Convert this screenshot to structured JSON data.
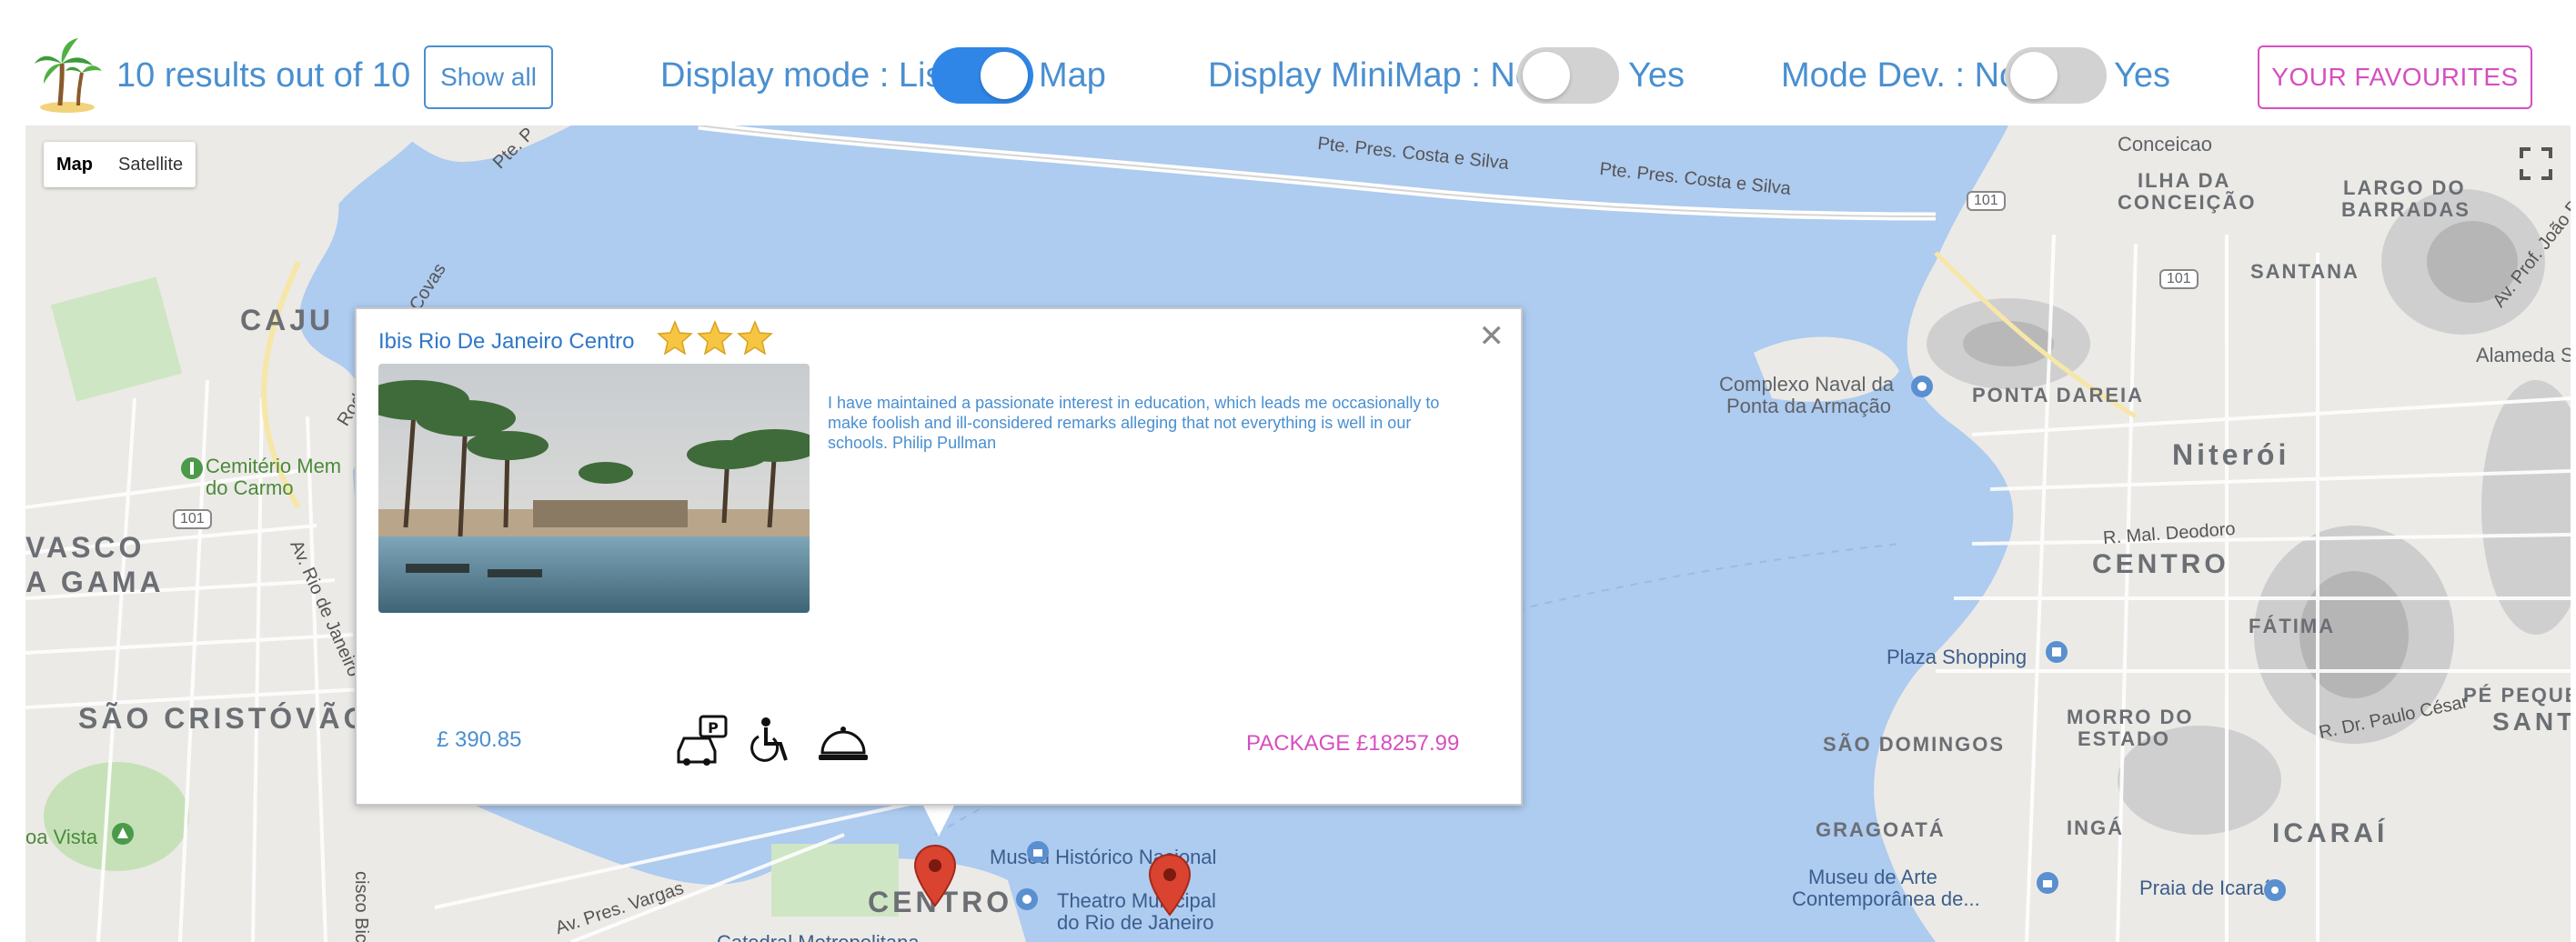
{
  "header": {
    "results_text": "10 results out of 10",
    "show_all_label": "Show all",
    "display_mode": {
      "label": "Display mode : List",
      "after": "Map",
      "enabled": true
    },
    "minimap": {
      "label": "Display MiniMap : No",
      "after": "Yes",
      "enabled": false
    },
    "mode_dev": {
      "label": "Mode Dev. : No",
      "after": "Yes",
      "enabled": false
    },
    "favourites_label": "YOUR FAVOURITES",
    "accent_color": "#4a8fd0",
    "favourites_color": "#d64fbf",
    "toggle_on_color": "#2f86e6"
  },
  "map": {
    "type_control": {
      "map_label": "Map",
      "satellite_label": "Satellite",
      "selected": "Map"
    },
    "labels": {
      "caju": "CAJU",
      "vasco": "VASCO",
      "gama": "A GAMA",
      "sao_cristovao": "SÃO CRISTÓVÃO",
      "cemiterio": "Cemitério Mem",
      "do_carmo": "do Carmo",
      "boa_vista": "oa Vista",
      "centro_rio": "CENTRO",
      "museu_historico": "Museu Histórico Nacional",
      "theatro_1": "Theatro Municipal",
      "theatro_2": "do Rio de Janeiro",
      "catedral": "Catedral Metropolitana",
      "av_pres_vargas": "Av. Pres. Vargas",
      "francisco_bicalho": "cisco Bicalho",
      "av_rio_de_janeiro": "Av. Rio de Janeiro",
      "rod_mario_covas": "Rod. Gov. Mário Covas",
      "pte_pres_costa_1": "Pte. Pres. Costa e Silva",
      "pte_pres_costa_2": "Pte. Pres. Costa e Silva",
      "pte_p": "Pte. P",
      "conceicao": "Conceicao",
      "ilha_da": "ILHA DA",
      "conceicao_caps": "CONCEIÇÃO",
      "largo_do": "LARGO DO",
      "barradas": "BARRADAS",
      "santana": "SANTANA",
      "av_prof_joao": "Av. Prof. João B",
      "alameda": "Alameda Sa",
      "complexo_1": "Complexo Naval da",
      "complexo_2": "Ponta da Armação",
      "ponta_dareia": "PONTA DAREIA",
      "niteroi": "Niterói",
      "r_mal_deodoro": "R. Mal. Deodoro",
      "centro_niteroi": "CENTRO",
      "fatima": "FÁTIMA",
      "plaza_shopping": "Plaza Shopping",
      "pe_pequeno": "PÉ PEQUENO",
      "santa_r": "SANTA R",
      "morro_do": "MORRO DO",
      "estado": "ESTADO",
      "r_dr_paulo_cesar": "R. Dr. Paulo César",
      "sao_domingos": "SÃO DOMINGOS",
      "gragoata": "GRAGOATÁ",
      "inga": "INGÁ",
      "icarai": "ICARAÍ",
      "museu_arte_1": "Museu de Arte",
      "museu_arte_2": "Contemporânea de...",
      "praia_icarai": "Praia de Icaraí",
      "shield_101_a": "101",
      "shield_101_b": "101",
      "shield_101_c": "101"
    }
  },
  "infowindow": {
    "hotel_name": "Ibis Rio De Janeiro Centro",
    "stars": 3,
    "description": "I have maintained a passionate interest in education, which leads me occasionally to make foolish and ill-considered remarks alleging that not everything is well in our schools. Philip Pullman",
    "price": "£ 390.85",
    "package": "PACKAGE £18257.99",
    "amenities": [
      "parking-icon",
      "accessible-icon",
      "room-service-icon"
    ]
  }
}
